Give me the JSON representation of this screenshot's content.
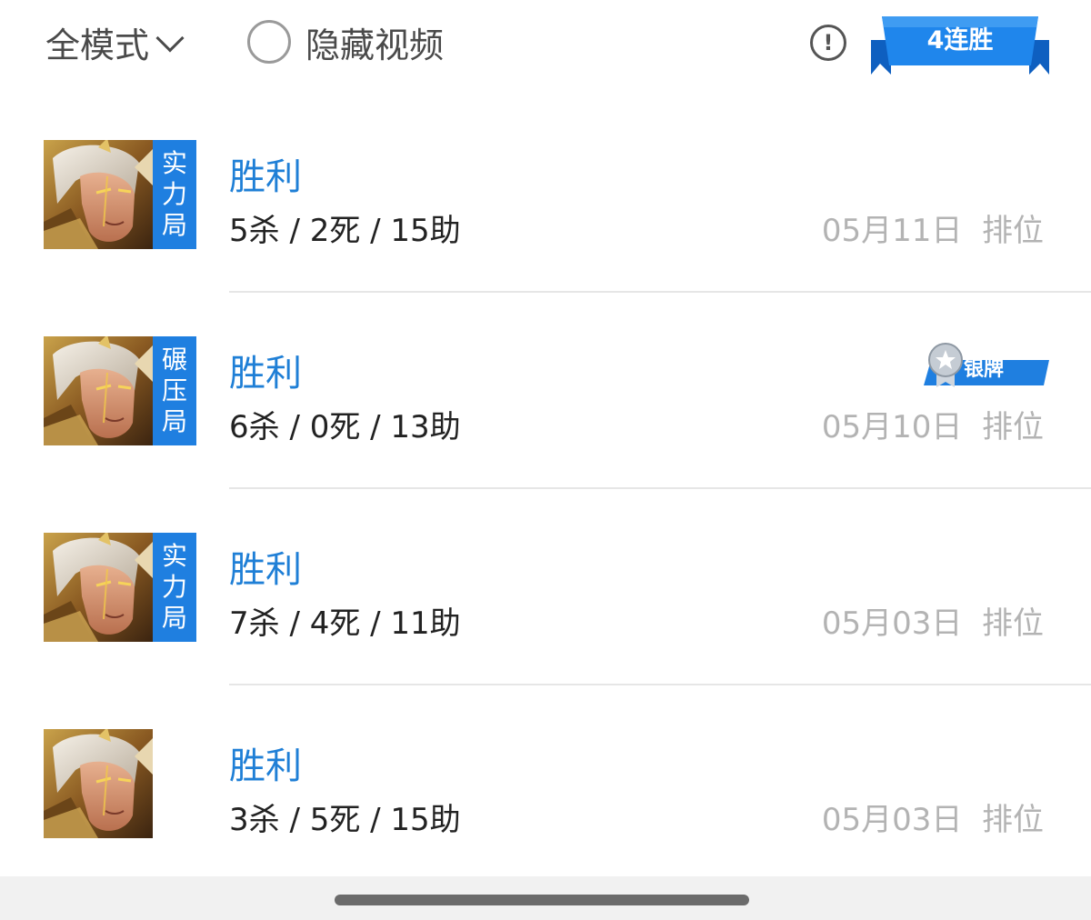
{
  "header": {
    "mode_filter": "全模式",
    "hide_video_label": "隐藏视频",
    "streak_label": "4连胜"
  },
  "colors": {
    "accent_blue": "#1f7fe0",
    "result_blue": "#1f7fd6",
    "meta_gray": "#b3b3b3",
    "kda_text": "#222222"
  },
  "matches": [
    {
      "mode_tag": [
        "实",
        "力",
        "局"
      ],
      "result": "胜利",
      "kda": "5杀 / 2死 / 15助",
      "date": "05月11日",
      "type": "排位",
      "medal": ""
    },
    {
      "mode_tag": [
        "碾",
        "压",
        "局"
      ],
      "result": "胜利",
      "kda": "6杀 / 0死 / 13助",
      "date": "05月10日",
      "type": "排位",
      "medal": "银牌"
    },
    {
      "mode_tag": [
        "实",
        "力",
        "局"
      ],
      "result": "胜利",
      "kda": "7杀 / 4死 / 11助",
      "date": "05月03日",
      "type": "排位",
      "medal": ""
    },
    {
      "mode_tag": [],
      "result": "胜利",
      "kda": "3杀 / 5死 / 15助",
      "date": "05月03日",
      "type": "排位",
      "medal": ""
    }
  ]
}
